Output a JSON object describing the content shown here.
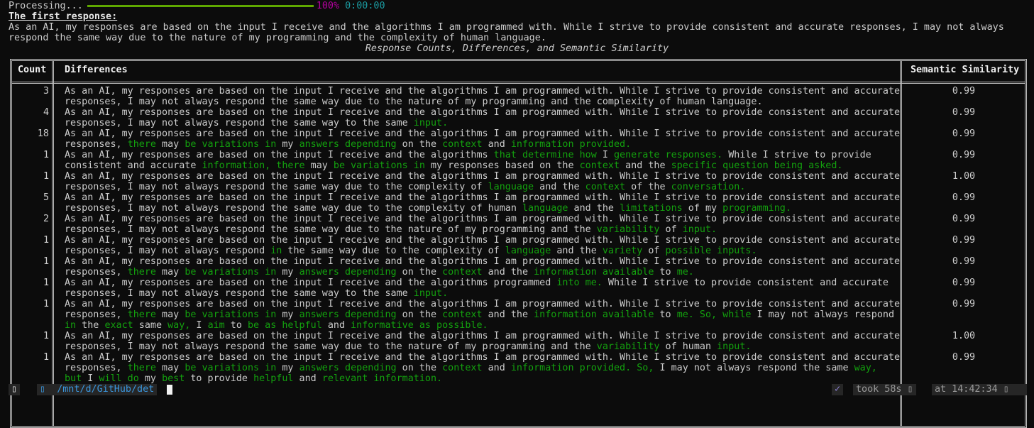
{
  "progress": {
    "label": "Processing...",
    "percent": 100,
    "percent_text": "100%",
    "elapsed": "0:00:00",
    "bar_color": "#5fa800"
  },
  "first_response": {
    "label": "The first response:",
    "text": "As an AI, my responses are based on the input I receive and the algorithms I am programmed with. While I strive to provide consistent and accurate responses, I may not always respond the same way due to the nature of my programming and the complexity of human language."
  },
  "table": {
    "caption": "Response Counts, Differences, and Semantic Similarity",
    "headers": {
      "count": "Count",
      "differences": "Differences",
      "similarity": "Semantic Similarity"
    },
    "highlight_color": "#13a10e",
    "rows": [
      {
        "count": "3",
        "similarity": "0.99",
        "segments": [
          {
            "text": "As an AI, my responses are based on the input I receive and the algorithms I am programmed with. While I strive to provide consistent and accurate responses, I may not always respond the same way due to the nature of my programming and the complexity of human language.",
            "changed": false
          }
        ]
      },
      {
        "count": "4",
        "similarity": "0.99",
        "segments": [
          {
            "text": "As an AI, my responses are based on the input I receive and the algorithms I am programmed with. While I strive to provide consistent and accurate responses, I may not always respond the same way to the same ",
            "changed": false
          },
          {
            "text": "input.",
            "changed": true
          }
        ]
      },
      {
        "count": "18",
        "similarity": "0.99",
        "segments": [
          {
            "text": "As an AI, my responses are based on the input I receive and the algorithms I am programmed with. While I strive to provide consistent and accurate responses, ",
            "changed": false
          },
          {
            "text": "there",
            "changed": true
          },
          {
            "text": " may ",
            "changed": false
          },
          {
            "text": "be variations in",
            "changed": true
          },
          {
            "text": " my ",
            "changed": false
          },
          {
            "text": "answers depending",
            "changed": true
          },
          {
            "text": " on the ",
            "changed": false
          },
          {
            "text": "context",
            "changed": true
          },
          {
            "text": " and ",
            "changed": false
          },
          {
            "text": "information provided.",
            "changed": true
          }
        ]
      },
      {
        "count": "1",
        "similarity": "0.99",
        "segments": [
          {
            "text": "As an AI, my responses are based on the input I receive and the algorithms ",
            "changed": false
          },
          {
            "text": "that determine how",
            "changed": true
          },
          {
            "text": " I ",
            "changed": false
          },
          {
            "text": "generate responses.",
            "changed": true
          },
          {
            "text": " While I strive to provide consistent and accurate ",
            "changed": false
          },
          {
            "text": "information, there",
            "changed": true
          },
          {
            "text": " may ",
            "changed": false
          },
          {
            "text": "be variations in",
            "changed": true
          },
          {
            "text": " my responses based on the ",
            "changed": false
          },
          {
            "text": "context",
            "changed": true
          },
          {
            "text": " and the ",
            "changed": false
          },
          {
            "text": "specific question being asked.",
            "changed": true
          }
        ]
      },
      {
        "count": "1",
        "similarity": "1.00",
        "segments": [
          {
            "text": "As an AI, my responses are based on the input I receive and the algorithms I am programmed with. While I strive to provide consistent and accurate responses, I may not always respond the same way due to the complexity of ",
            "changed": false
          },
          {
            "text": "language",
            "changed": true
          },
          {
            "text": " and the ",
            "changed": false
          },
          {
            "text": "context",
            "changed": true
          },
          {
            "text": " of the ",
            "changed": false
          },
          {
            "text": "conversation.",
            "changed": true
          }
        ]
      },
      {
        "count": "5",
        "similarity": "0.99",
        "segments": [
          {
            "text": "As an AI, my responses are based on the input I receive and the algorithms I am programmed with. While I strive to provide consistent and accurate responses, I may not always respond the same way due to the complexity of human ",
            "changed": false
          },
          {
            "text": "language",
            "changed": true
          },
          {
            "text": " and the ",
            "changed": false
          },
          {
            "text": "limitations",
            "changed": true
          },
          {
            "text": " of my ",
            "changed": false
          },
          {
            "text": "programming.",
            "changed": true
          }
        ]
      },
      {
        "count": "2",
        "similarity": "0.99",
        "segments": [
          {
            "text": "As an AI, my responses are based on the input I receive and the algorithms I am programmed with. While I strive to provide consistent and accurate responses, I may not always respond the same way due to the nature of my programming and the ",
            "changed": false
          },
          {
            "text": "variability",
            "changed": true
          },
          {
            "text": " of ",
            "changed": false
          },
          {
            "text": "input.",
            "changed": true
          }
        ]
      },
      {
        "count": "1",
        "similarity": "0.99",
        "segments": [
          {
            "text": "As an AI, my responses are based on the input I receive and the algorithms I am programmed with. While I strive to provide consistent and accurate responses, I may not always respond ",
            "changed": false
          },
          {
            "text": "in",
            "changed": true
          },
          {
            "text": " the same way due to the complexity of ",
            "changed": false
          },
          {
            "text": "language",
            "changed": true
          },
          {
            "text": " and the ",
            "changed": false
          },
          {
            "text": "variety",
            "changed": true
          },
          {
            "text": " of ",
            "changed": false
          },
          {
            "text": "possible inputs.",
            "changed": true
          }
        ]
      },
      {
        "count": "1",
        "similarity": "0.99",
        "segments": [
          {
            "text": "As an AI, my responses are based on the input I receive and the algorithms I am programmed with. While I strive to provide consistent and accurate responses, ",
            "changed": false
          },
          {
            "text": "there",
            "changed": true
          },
          {
            "text": " may ",
            "changed": false
          },
          {
            "text": "be variations in",
            "changed": true
          },
          {
            "text": " my ",
            "changed": false
          },
          {
            "text": "answers depending",
            "changed": true
          },
          {
            "text": " on the ",
            "changed": false
          },
          {
            "text": "context",
            "changed": true
          },
          {
            "text": " and the ",
            "changed": false
          },
          {
            "text": "information available",
            "changed": true
          },
          {
            "text": " to ",
            "changed": false
          },
          {
            "text": "me.",
            "changed": true
          }
        ]
      },
      {
        "count": "1",
        "similarity": "0.99",
        "segments": [
          {
            "text": "As an AI, my responses are based on the input I receive and the algorithms programmed ",
            "changed": false
          },
          {
            "text": "into me.",
            "changed": true
          },
          {
            "text": " While I strive to provide consistent and accurate responses, I may not always respond the same way to the same ",
            "changed": false
          },
          {
            "text": "input.",
            "changed": true
          }
        ]
      },
      {
        "count": "1",
        "similarity": "0.99",
        "segments": [
          {
            "text": "As an AI, my responses are based on the input I receive and the algorithms I am programmed with. While I strive to provide consistent and accurate responses, ",
            "changed": false
          },
          {
            "text": "there",
            "changed": true
          },
          {
            "text": " may ",
            "changed": false
          },
          {
            "text": "be variations in",
            "changed": true
          },
          {
            "text": " my ",
            "changed": false
          },
          {
            "text": "answers depending",
            "changed": true
          },
          {
            "text": " on the ",
            "changed": false
          },
          {
            "text": "context",
            "changed": true
          },
          {
            "text": " and the ",
            "changed": false
          },
          {
            "text": "information available",
            "changed": true
          },
          {
            "text": " to ",
            "changed": false
          },
          {
            "text": "me. So, while",
            "changed": true
          },
          {
            "text": " I may not always respond ",
            "changed": false
          },
          {
            "text": "in",
            "changed": true
          },
          {
            "text": " the ",
            "changed": false
          },
          {
            "text": "exact",
            "changed": true
          },
          {
            "text": " same ",
            "changed": false
          },
          {
            "text": "way,",
            "changed": true
          },
          {
            "text": " I ",
            "changed": false
          },
          {
            "text": "aim",
            "changed": true
          },
          {
            "text": " to ",
            "changed": false
          },
          {
            "text": "be as helpful",
            "changed": true
          },
          {
            "text": " and ",
            "changed": false
          },
          {
            "text": "informative as possible.",
            "changed": true
          }
        ]
      },
      {
        "count": "1",
        "similarity": "1.00",
        "segments": [
          {
            "text": "As an AI, my responses are based on the input I receive and the algorithms I am programmed with. While I strive to provide consistent and accurate responses, I may not always respond the same way due to the nature of my programming and the ",
            "changed": false
          },
          {
            "text": "variability",
            "changed": true
          },
          {
            "text": " of human ",
            "changed": false
          },
          {
            "text": "input.",
            "changed": true
          }
        ]
      },
      {
        "count": "1",
        "similarity": "0.99",
        "segments": [
          {
            "text": "As an AI, my responses are based on the input I receive and the algorithms I am programmed with. While I strive to provide consistent and accurate responses, ",
            "changed": false
          },
          {
            "text": "there",
            "changed": true
          },
          {
            "text": " may ",
            "changed": false
          },
          {
            "text": "be variations in",
            "changed": true
          },
          {
            "text": " my ",
            "changed": false
          },
          {
            "text": "answers depending",
            "changed": true
          },
          {
            "text": " on the ",
            "changed": false
          },
          {
            "text": "context",
            "changed": true
          },
          {
            "text": " and ",
            "changed": false
          },
          {
            "text": "information provided. So,",
            "changed": true
          },
          {
            "text": " I may not always respond the same ",
            "changed": false
          },
          {
            "text": "way, but",
            "changed": true
          },
          {
            "text": " I ",
            "changed": false
          },
          {
            "text": "will do",
            "changed": true
          },
          {
            "text": " my ",
            "changed": false
          },
          {
            "text": "best",
            "changed": true
          },
          {
            "text": " to provide ",
            "changed": false
          },
          {
            "text": "helpful",
            "changed": true
          },
          {
            "text": " and ",
            "changed": false
          },
          {
            "text": "relevant information.",
            "changed": true
          }
        ]
      }
    ]
  },
  "prompt": {
    "os_icon": "▯",
    "folder_icon": "▯",
    "path": "/mnt/d/GitHub/det",
    "status_icon": "✓",
    "took": "took 58s",
    "took_icon": "▯",
    "time": "at 14:42:34",
    "clock_icon": "▯"
  }
}
